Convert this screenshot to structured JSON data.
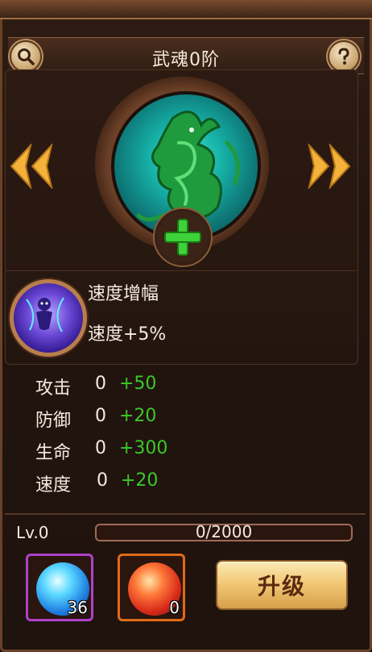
{
  "header": {
    "title": "武魂0阶"
  },
  "skill": {
    "name": "速度增幅",
    "description": "速度+5%"
  },
  "stats": [
    {
      "label": "攻击",
      "value": "0",
      "bonus": "+50"
    },
    {
      "label": "防御",
      "value": "0",
      "bonus": "+20"
    },
    {
      "label": "生命",
      "value": "0",
      "bonus": "+300"
    },
    {
      "label": "速度",
      "value": "0",
      "bonus": "+20"
    }
  ],
  "level": {
    "label": "Lv.0",
    "exp_text": "0/2000",
    "exp_fraction": 0
  },
  "items": [
    {
      "icon": "blue-orb-icon",
      "count": "36",
      "border_color": "#b040c8"
    },
    {
      "icon": "red-orb-icon",
      "count": "0",
      "border_color": "#e06a1a"
    }
  ],
  "buttons": {
    "upgrade": "升级"
  },
  "colors": {
    "bonus_green": "#3cc829",
    "button_gold": "#f2c978",
    "panel_brown": "#2c1a12"
  }
}
